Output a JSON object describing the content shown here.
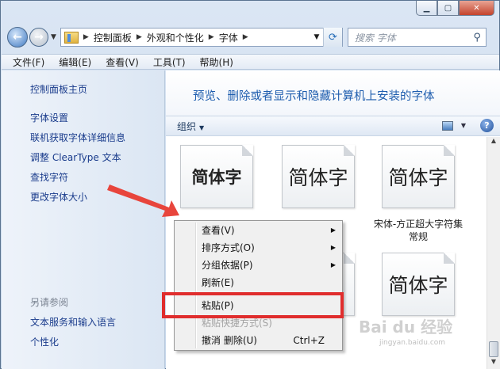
{
  "window": {
    "min_glyph": "▁",
    "max_glyph": "▢",
    "close_glyph": "✕"
  },
  "nav": {
    "breadcrumbs": [
      "控制面板",
      "外观和个性化",
      "字体"
    ],
    "search_placeholder": "搜索 字体"
  },
  "menubar": [
    "文件(F)",
    "编辑(E)",
    "查看(V)",
    "工具(T)",
    "帮助(H)"
  ],
  "left_pane": {
    "links": [
      "控制面板主页",
      "字体设置",
      "联机获取字体详细信息",
      "调整 ClearType 文本",
      "查找字符",
      "更改字体大小"
    ],
    "see_also_heading": "另请参阅",
    "see_also_links": [
      "文本服务和输入语言",
      "个性化"
    ]
  },
  "right_pane": {
    "banner_title": "预览、删除或者显示和隐藏计算机上安装的字体",
    "organize_label": "组织",
    "tiles": [
      {
        "glyph": "简体字",
        "caption": ""
      },
      {
        "glyph": "简体字",
        "caption": ""
      },
      {
        "glyph": "简体字",
        "caption": "宋体-方正超大字符集 常规"
      },
      {
        "glyph": "简体字",
        "caption": ""
      }
    ]
  },
  "context_menu": {
    "items": [
      {
        "label": "查看(V)",
        "submenu": true,
        "disabled": false,
        "shortcut": ""
      },
      {
        "label": "排序方式(O)",
        "submenu": true,
        "disabled": false,
        "shortcut": ""
      },
      {
        "label": "分组依据(P)",
        "submenu": true,
        "disabled": false,
        "shortcut": ""
      },
      {
        "label": "刷新(E)",
        "submenu": false,
        "disabled": false,
        "shortcut": ""
      },
      {
        "label": "粘贴(P)",
        "submenu": false,
        "disabled": false,
        "shortcut": ""
      },
      {
        "label": "粘贴快捷方式(S)",
        "submenu": false,
        "disabled": true,
        "shortcut": ""
      },
      {
        "label": "撤消 删除(U)",
        "submenu": false,
        "disabled": false,
        "shortcut": "Ctrl+Z"
      }
    ]
  },
  "watermark": {
    "text": "Bai du 经验",
    "sub": "jingyan.baidu.com"
  },
  "colors": {
    "link": "#1a3c8c",
    "banner_title": "#1e5dae",
    "highlight_box": "#e02d2d",
    "arrow": "#e8453c"
  }
}
